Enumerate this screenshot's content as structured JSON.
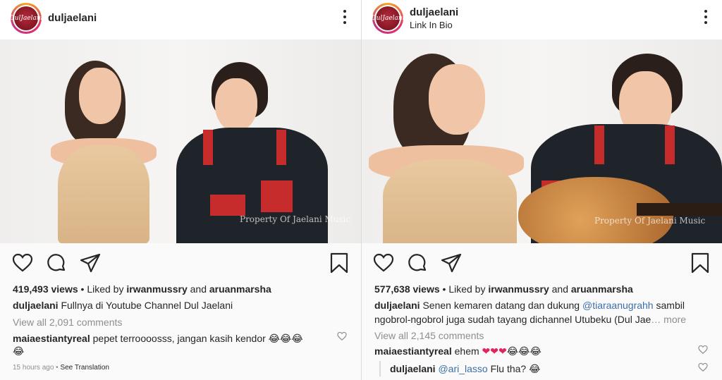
{
  "left_post": {
    "username": "duljaelani",
    "views": "419,493 views",
    "liked_by_prefix": " • Liked by ",
    "liked_user1": "irwanmussry",
    "liked_and": " and ",
    "liked_user2": "aruanmarsha",
    "caption_user": "duljaelani",
    "caption_text": " Fullnya di Youtube Channel Dul Jaelani",
    "view_all": "View all 2,091 comments",
    "comment_user": "maiaestiantyreal",
    "comment_text": " pepet terroooosss, jangan kasih kendor ",
    "comment_emoji": "😂😂😂",
    "comment_emoji_line2": "😂",
    "timestamp": "15 hours ago",
    "separator": " • ",
    "see_translation": "See Translation",
    "watermark": "Property Of Jaelani Music",
    "avatar_text": "DulJaelani"
  },
  "right_post": {
    "username": "duljaelani",
    "subtitle": "Link In Bio",
    "views": "577,638 views",
    "liked_by_prefix": " • Liked by ",
    "liked_user1": "irwanmussry",
    "liked_and": " and ",
    "liked_user2": "aruanmarsha",
    "caption_user": "duljaelani",
    "caption_text1": " Senen kemaren datang dan dukung ",
    "caption_mention": "@tiaraanugrahh",
    "caption_text2": " sambil",
    "caption_line2": "ngobrol-ngobrol juga sudah tayang dichannel Utubeku (Dul Jae",
    "caption_more": "… more",
    "view_all": "View all 2,145 comments",
    "comment_user": "maiaestiantyreal",
    "comment_text": " ehem ",
    "comment_hearts": "❤❤❤",
    "comment_emoji": "😂😂😂",
    "reply_user": "duljaelani",
    "reply_mention": "@ari_lasso",
    "reply_text": " Flu tha? ",
    "reply_emoji": "😂",
    "watermark": "Property Of Jaelani Music",
    "avatar_text": "DulJaelani"
  },
  "icons": [
    "heart-icon",
    "comment-icon",
    "share-icon",
    "bookmark-icon",
    "more-icon"
  ],
  "colors": {
    "text": "#262626",
    "secondary": "#8e8e8e",
    "link": "#3d6fa6",
    "heart": "#e0245e"
  }
}
